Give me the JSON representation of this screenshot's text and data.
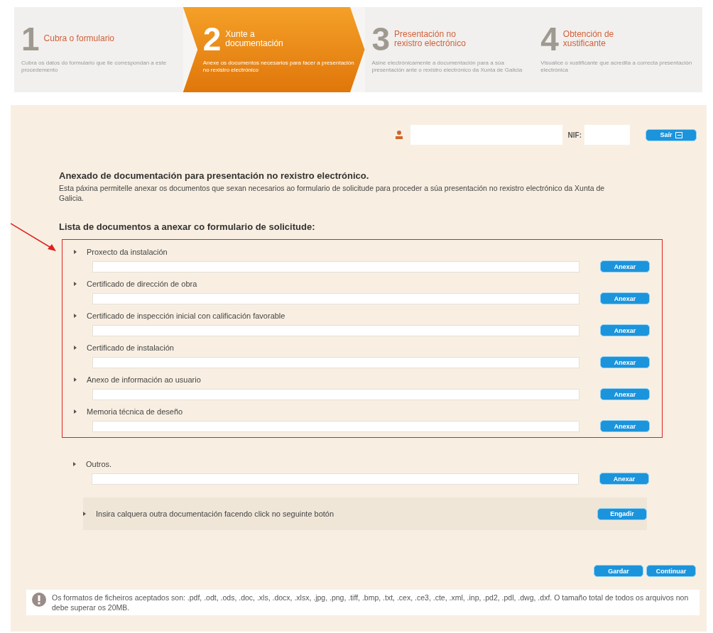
{
  "steps": [
    {
      "number": "1",
      "title": "Cubra o formulario",
      "description": "Cubra os datos do formulario que lle correspondan a este procedemento",
      "selected": false
    },
    {
      "number": "2",
      "title": "Xunte a documentación",
      "description": "Anexe os documentos necesarios para facer a presentación no rexistro electrónico",
      "selected": true
    },
    {
      "number": "3",
      "title": "Presentación no rexistro electrónico",
      "description": "Asine electrónicamente a documentación para a súa presentación ante o rexistro electrónico da Xunta de Galicia",
      "selected": false
    },
    {
      "number": "4",
      "title": "Obtención de xustificante",
      "description": "Visualice o xustificante que acredita a correcta presentación electrónica",
      "selected": false
    }
  ],
  "user_bar": {
    "nif_label": "NIF:",
    "exit_button": "Saír"
  },
  "heading": "Anexado de documentación para presentación no rexistro electrónico.",
  "intro": "Esta páxina permitelle anexar os documentos que sexan necesarios ao formulario de solicitude para proceder a súa presentación no rexistro electrónico da Xunta de Galicia.",
  "list_title": "Lista de documentos a anexar co formulario de solicitude:",
  "highlighted_documents": [
    {
      "name": "Proxecto da instalación",
      "button": "Anexar"
    },
    {
      "name": "Certificado de dirección de obra",
      "button": "Anexar"
    },
    {
      "name": "Certificado de inspección inicial con calificación favorable",
      "button": "Anexar"
    },
    {
      "name": "Certificado de instalación",
      "button": "Anexar"
    },
    {
      "name": "Anexo de información ao usuario",
      "button": "Anexar"
    },
    {
      "name": "Memoria técnica de deseño",
      "button": "Anexar"
    }
  ],
  "other_documents": [
    {
      "name": "Outros.",
      "button": "Anexar"
    }
  ],
  "add_row": {
    "text": "Insira calquera outra documentación facendo click no seguinte botón",
    "button": "Engadir"
  },
  "actions": [
    "Gardar",
    "Continuar"
  ],
  "notice": "Os formatos de ficheiros aceptados son: .pdf, .odt, .ods, .doc, .xls, .docx, .xlsx, .jpg, .png, .tiff, .bmp, .txt, .cex, .ce3, .cte, .xml, .inp, .pd2, .pdl, .dwg, .dxf. O tamaño total de todos os arquivos non debe superar os 20MB."
}
